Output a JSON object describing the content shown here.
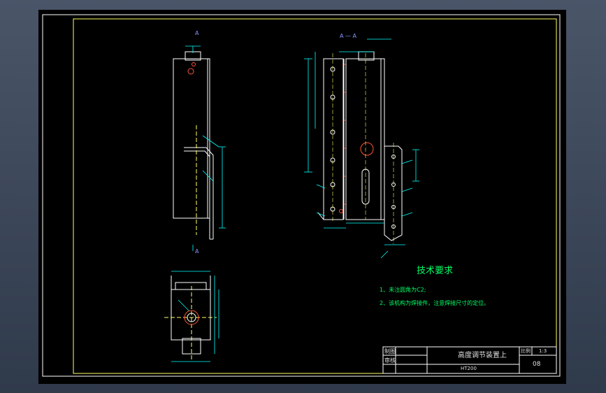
{
  "drawing": {
    "section_marks": {
      "left_top": "A",
      "left_bottom": "A",
      "section_title": "A — A"
    },
    "technical_requirements": {
      "title": "技术要求",
      "items": [
        "1、未注圆角为C2;",
        "2、该机构为焊接件，注意焊接尺寸的定位。"
      ]
    },
    "title_block": {
      "label_design": "制图",
      "label_check": "审核",
      "drawing_name": "高度调节装置上",
      "label_scale": "比例",
      "scale": "1:3",
      "material": "HT200",
      "sheet_number": "08"
    }
  },
  "colors": {
    "background": "#000000",
    "outline": "#ffffff",
    "frame": "#ffff66",
    "dimension": "#00ffff",
    "hole": "#ff5533",
    "text_green": "#00ff66",
    "section": "#8899ff"
  }
}
